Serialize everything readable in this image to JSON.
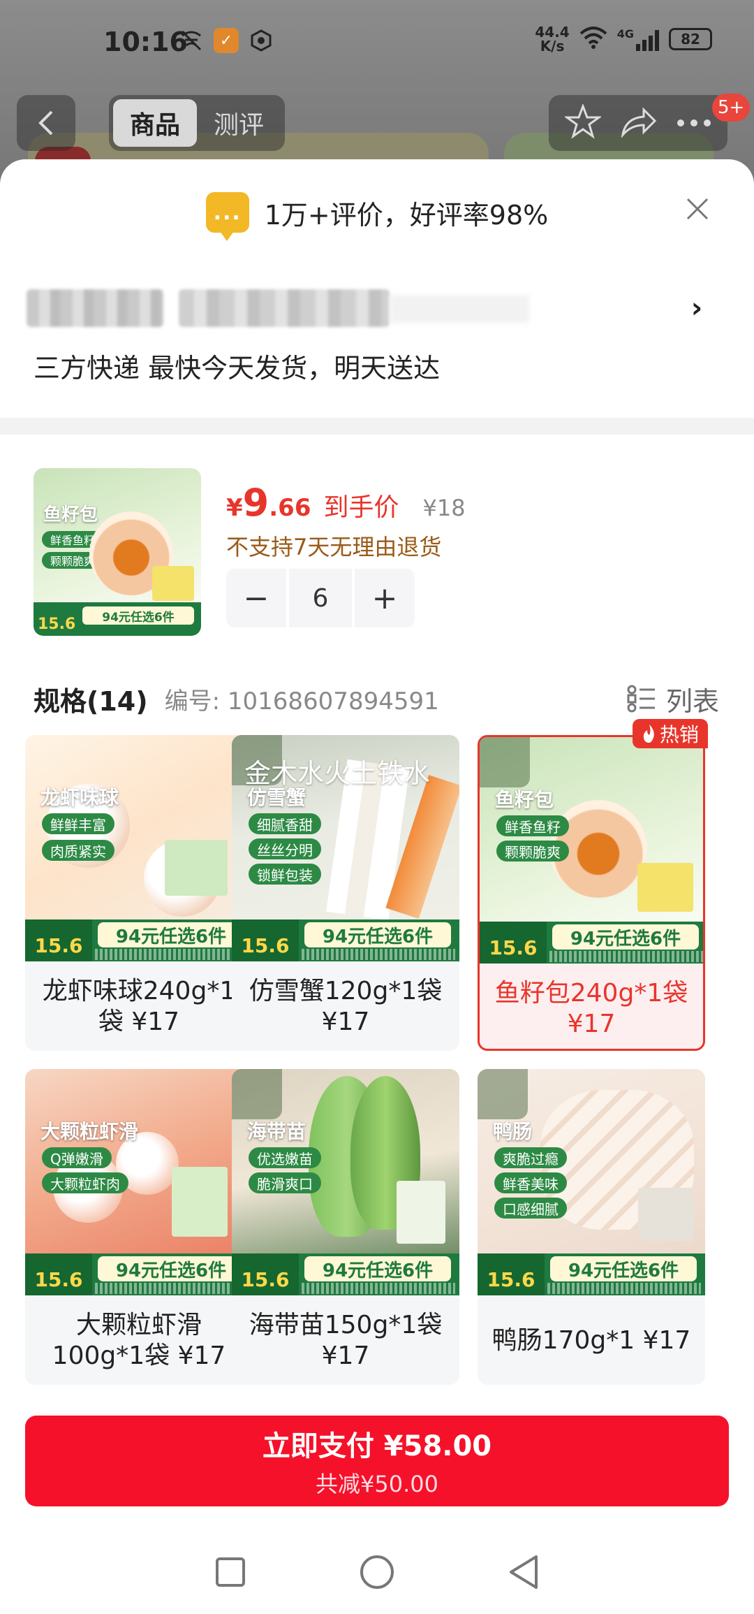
{
  "status_bar": {
    "time": "10:16",
    "net_speed_value": "44.4",
    "net_speed_unit": "K/s",
    "network": "4G",
    "battery": "82"
  },
  "top_nav": {
    "tabs": [
      {
        "label": "商品",
        "active": true
      },
      {
        "label": "测评",
        "active": false
      }
    ],
    "cart_badge": "5+"
  },
  "sheet": {
    "review_icon_text": "...",
    "review_summary": "1万+评价，好评率98%",
    "address_arrow": "›",
    "delivery": "三方快递 最快今天发货，明天送达"
  },
  "product": {
    "currency": "¥",
    "price_int": "9",
    "price_dec": ".66",
    "price_label": "到手价",
    "original_price": "¥18",
    "return_policy": "不支持7天无理由退货",
    "quantity": "6",
    "minus": "−",
    "plus": "+"
  },
  "spec": {
    "title": "规格(14)",
    "code": "编号: 10168607894591",
    "view_toggle": "列表",
    "hot_tag": "热销",
    "promo_text": "94元任选6件",
    "promo_price": "15.6",
    "items": [
      {
        "title": "龙虾味球240g*1袋 ¥17",
        "img_label": "龙虾味球",
        "chips": [
          "鲜鲜丰富",
          "肉质紧实"
        ],
        "overtext": "",
        "selected": false
      },
      {
        "title": "仿雪蟹120g*1袋 ¥17",
        "img_label": "仿雪蟹",
        "chips": [
          "细腻香甜",
          "丝丝分明",
          "锁鲜包装"
        ],
        "overtext": "金木水火土铁水",
        "selected": false
      },
      {
        "title": "鱼籽包240g*1袋 ¥17",
        "img_label": "鱼籽包",
        "chips": [
          "鲜香鱼籽",
          "颗颗脆爽"
        ],
        "overtext": "",
        "selected": true
      },
      {
        "title": "大颗粒虾滑100g*1袋 ¥17",
        "img_label": "大颗粒虾滑",
        "chips": [
          "Q弹嫩滑",
          "大颗粒虾肉"
        ],
        "overtext": "",
        "selected": false
      },
      {
        "title": "海带苗150g*1袋 ¥17",
        "img_label": "海带苗",
        "chips": [
          "优选嫩苗",
          "脆滑爽口"
        ],
        "overtext": "",
        "selected": false
      },
      {
        "title": "鸭肠170g*1 ¥17",
        "img_label": "鸭肠",
        "chips": [
          "爽脆过瘾",
          "鲜香美味",
          "口感细腻"
        ],
        "overtext": "",
        "selected": false
      }
    ]
  },
  "thumb": {
    "label": "鱼籽包",
    "chips": [
      "鲜香鱼籽",
      "颗颗脆爽"
    ],
    "promo_price": "15.6",
    "promo_text": "94元任选6件"
  },
  "pay": {
    "label": "立即支付 ¥58.00",
    "discount": "共减¥50.00"
  },
  "colors": {
    "accent_red": "#e8352b",
    "pay_red": "#f5112a",
    "review_yellow": "#f2b826",
    "promo_green": "#1f7a3f"
  }
}
